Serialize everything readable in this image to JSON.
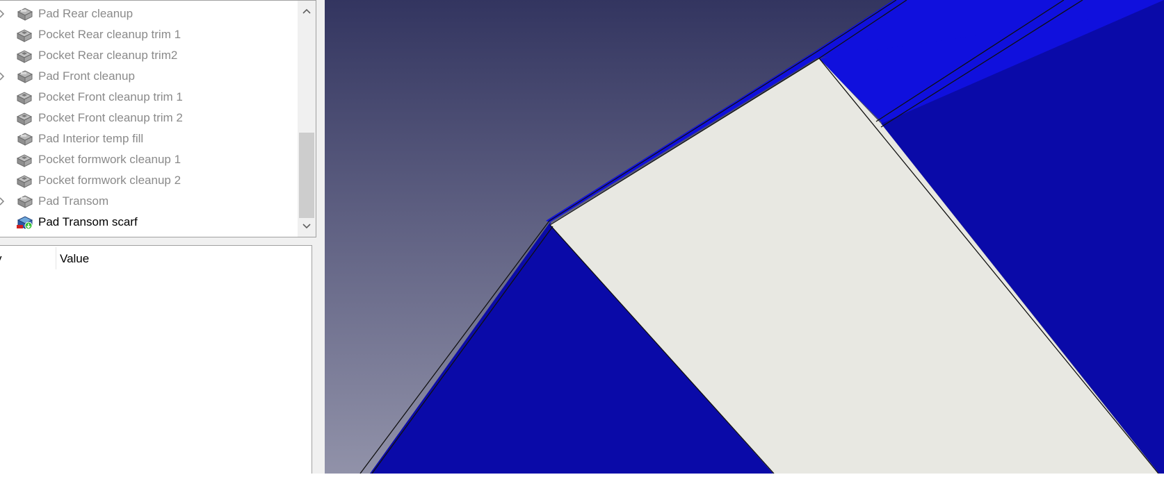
{
  "tree": {
    "items": [
      {
        "label": "Pad Rear cleanup",
        "icon": "pad-icon",
        "expandable": true,
        "active": false
      },
      {
        "label": "Pocket Rear cleanup trim 1",
        "icon": "pocket-icon",
        "expandable": false,
        "active": false
      },
      {
        "label": "Pocket Rear cleanup trim2",
        "icon": "pocket-icon",
        "expandable": false,
        "active": false
      },
      {
        "label": "Pad Front cleanup",
        "icon": "pad-icon",
        "expandable": true,
        "active": false
      },
      {
        "label": "Pocket Front cleanup trim 1",
        "icon": "pocket-icon",
        "expandable": false,
        "active": false
      },
      {
        "label": "Pocket Front cleanup trim 2",
        "icon": "pocket-icon",
        "expandable": false,
        "active": false
      },
      {
        "label": "Pad Interior temp fill",
        "icon": "pad-icon",
        "expandable": false,
        "active": false
      },
      {
        "label": "Pocket formwork cleanup 1",
        "icon": "pocket-icon",
        "expandable": false,
        "active": false
      },
      {
        "label": "Pocket formwork cleanup 2",
        "icon": "pocket-icon",
        "expandable": false,
        "active": false
      },
      {
        "label": "Pad Transom",
        "icon": "pad-icon",
        "expandable": true,
        "active": false
      },
      {
        "label": "Pad Transom scarf",
        "icon": "pad-tip-icon",
        "expandable": false,
        "active": true
      }
    ],
    "scroll_position": 0.56
  },
  "properties": {
    "column_property": "y",
    "column_value": "Value"
  },
  "viewport": {
    "background_top": "#333560",
    "background_bottom": "#9192a9",
    "face_light_blue": "#1010dd",
    "face_dark_blue": "#0a0aa8",
    "face_white": "#e8e8e2"
  }
}
